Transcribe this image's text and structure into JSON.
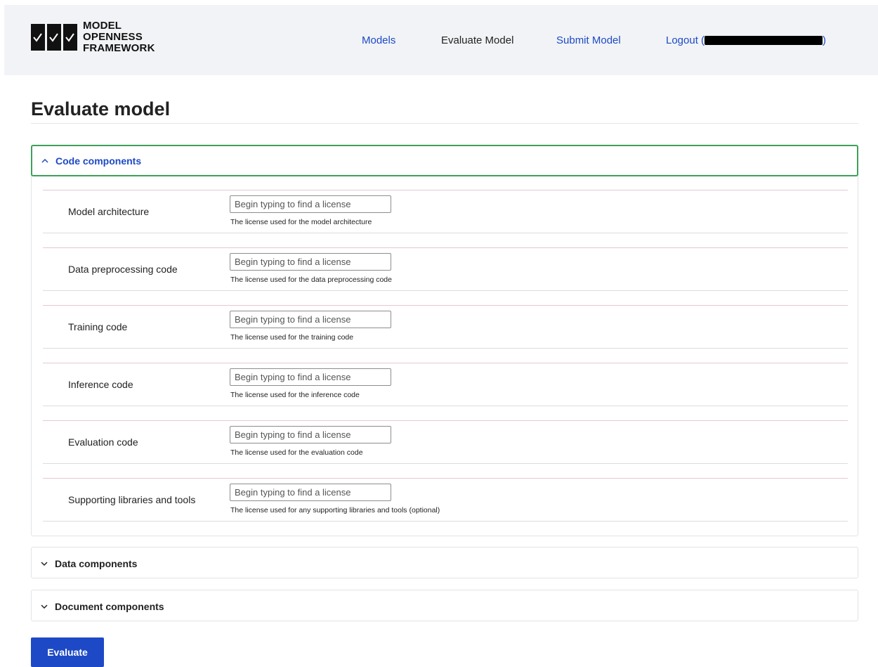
{
  "header": {
    "logo": {
      "line1": "MODEL",
      "line2": "OPENNESS",
      "line3": "FRAMEWORK"
    },
    "nav": {
      "models": "Models",
      "evaluate": "Evaluate Model",
      "submit": "Submit Model",
      "logout_prefix": "Logout (",
      "logout_suffix": ")"
    }
  },
  "page": {
    "title": "Evaluate model"
  },
  "sections": {
    "code": {
      "label": "Code components",
      "expanded": true
    },
    "data": {
      "label": "Data components",
      "expanded": false
    },
    "document": {
      "label": "Document components",
      "expanded": false
    }
  },
  "fields": [
    {
      "label": "Model architecture",
      "placeholder": "Begin typing to find a license",
      "help": "The license used for the model architecture"
    },
    {
      "label": "Data preprocessing code",
      "placeholder": "Begin typing to find a license",
      "help": "The license used for the data preprocessing code"
    },
    {
      "label": "Training code",
      "placeholder": "Begin typing to find a license",
      "help": "The license used for the training code"
    },
    {
      "label": "Inference code",
      "placeholder": "Begin typing to find a license",
      "help": "The license used for the inference code"
    },
    {
      "label": "Evaluation code",
      "placeholder": "Begin typing to find a license",
      "help": "The license used for the evaluation code"
    },
    {
      "label": "Supporting libraries and tools",
      "placeholder": "Begin typing to find a license",
      "help": "The license used for any supporting libraries and tools (optional)"
    }
  ],
  "actions": {
    "evaluate": "Evaluate"
  },
  "colors": {
    "link": "#1d49c6",
    "focus": "#3ea05a",
    "header_bg": "#f1f3f6"
  }
}
